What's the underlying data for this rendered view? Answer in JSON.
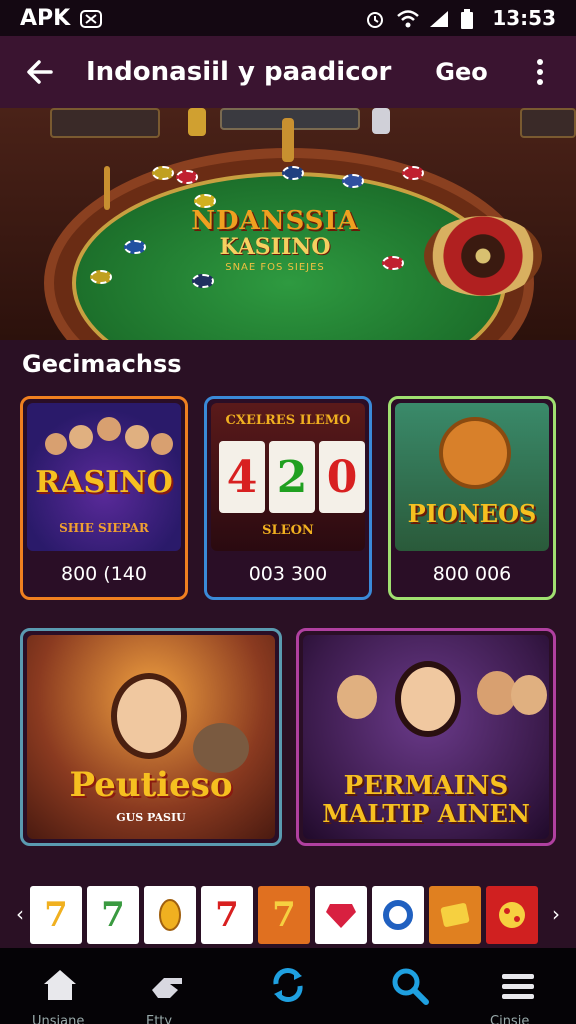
{
  "status_bar": {
    "carrier": "APK",
    "time": "13:53"
  },
  "app_bar": {
    "title": "Indonasiil y paadicor",
    "subtitle": "Geo"
  },
  "hero": {
    "logo_line1": "NDANSSIA",
    "logo_line2": "KASIINO",
    "logo_line3": "SNAE FOS SIEJES"
  },
  "section_title": "Gecimachss",
  "cards_row1": [
    {
      "art_title": "RASINO",
      "art_sub": "SHIE SIEPAR",
      "value": "800 (140"
    },
    {
      "art_title": "CXELRES ILEMO",
      "art_sub": "SLEON",
      "value": "003 300"
    },
    {
      "art_title": "PIONEOS",
      "art_sub": "",
      "value": "800 006"
    }
  ],
  "slot_digits": [
    "4",
    "2",
    "0"
  ],
  "cards_row2": [
    {
      "art_title": "Peutieso",
      "art_sub": "GUS PASIU"
    },
    {
      "art_title_line1": "PERMAINS",
      "art_title_line2": "MALTIP AINEN"
    }
  ],
  "strip": {
    "tiles": [
      "7",
      "7",
      "coin",
      "7",
      "7",
      "gem",
      "ring",
      "card",
      "dice"
    ]
  },
  "bottom_nav": {
    "items": [
      {
        "icon": "home-icon",
        "label": "Unsiane"
      },
      {
        "icon": "hand-icon",
        "label": "Etty"
      },
      {
        "icon": "refresh-icon",
        "label": ""
      },
      {
        "icon": "search-icon",
        "label": ""
      },
      {
        "icon": "menu-icon",
        "label": "Cinsie"
      }
    ]
  },
  "colors": {
    "background": "#2a1024",
    "app_bar": "#3a1430",
    "accent_blue": "#1fa0e0",
    "card_orange": "#f08020",
    "card_blue": "#3a8ad8",
    "card_green": "#a0e070",
    "card_teal": "#5a9ab0",
    "card_magenta": "#b040a0"
  }
}
